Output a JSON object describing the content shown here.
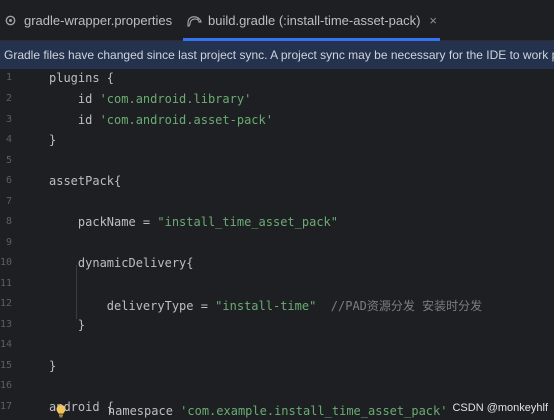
{
  "tabs": [
    {
      "label": "gradle-wrapper.properties",
      "icon": "gear-icon",
      "active": false
    },
    {
      "label": "build.gradle (:install-time-asset-pack)",
      "icon": "gradle-elephant-icon",
      "active": true,
      "close": "×"
    }
  ],
  "banner": {
    "text": "Gradle files have changed since last project sync. A project sync may be necessary for the IDE to work pro"
  },
  "line_numbers": [
    "1",
    "2",
    "3",
    "4",
    "5",
    "6",
    "7",
    "8",
    "9",
    "10",
    "11",
    "12",
    "13",
    "14",
    "15",
    "16",
    "17",
    "18"
  ],
  "code": {
    "l1": {
      "a": "plugins {"
    },
    "l2": {
      "a": "    id ",
      "b": "'com.android.library'"
    },
    "l3": {
      "a": "    id ",
      "b": "'com.android.asset-pack'"
    },
    "l4": {
      "a": "}"
    },
    "l6": {
      "a": "assetPack{"
    },
    "l8": {
      "a": "    packName = ",
      "b": "\"install_time_asset_pack\""
    },
    "l10": {
      "a": "    dynamicDelivery{"
    },
    "l12": {
      "a": "        deliveryType = ",
      "b": "\"install-time\"",
      "c": "  //PAD资源分发 安装时分发"
    },
    "l13": {
      "a": "    }"
    },
    "l15": {
      "a": "}"
    },
    "l17": {
      "a": "android {"
    },
    "l18": {
      "a": "    namespace ",
      "b": "'com.example.install_time_asset_pack'"
    }
  },
  "watermark": "CSDN @monkeyhlf",
  "colors": {
    "background": "#1e1f22",
    "banner": "#25324d",
    "string": "#6aab73",
    "comment": "#7a7e85",
    "tab_underline": "#3574f0"
  }
}
